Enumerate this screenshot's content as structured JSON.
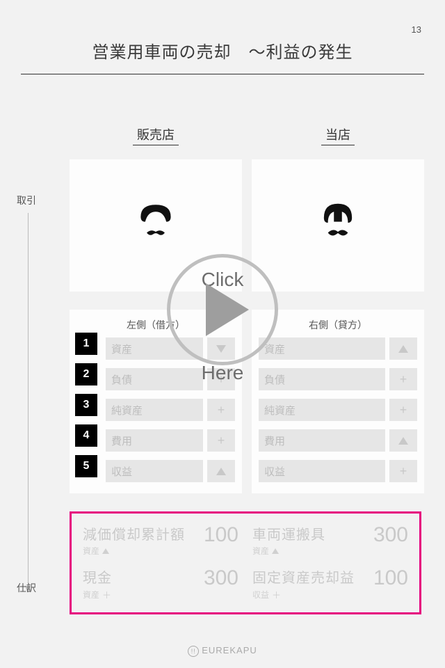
{
  "page_number": "13",
  "title": "営業用車両の売却　〜利益の発生",
  "side_labels": {
    "transaction": "取引",
    "journal": "仕訳"
  },
  "columns": {
    "left": "販売店",
    "right": "当店"
  },
  "table_headers": {
    "debit": "左側（借方）",
    "credit": "右側（貸方）"
  },
  "row_numbers": [
    "1",
    "2",
    "3",
    "4",
    "5"
  ],
  "categories": {
    "asset": "資産",
    "liability": "負債",
    "equity": "純資産",
    "expense": "費用",
    "revenue": "収益"
  },
  "journal": {
    "debit": [
      {
        "name": "減価償却累計額",
        "sub": "資産",
        "mark": "▲",
        "value": "100"
      },
      {
        "name": "現金",
        "sub": "資産",
        "mark": "＋",
        "value": "300"
      }
    ],
    "credit": [
      {
        "name": "車両運搬具",
        "sub": "資産",
        "mark": "▲",
        "value": "300"
      },
      {
        "name": "固定資産売却益",
        "sub": "収益",
        "mark": "＋",
        "value": "100"
      }
    ]
  },
  "overlay": {
    "click": "Click",
    "here": "Here"
  },
  "footer": "EUREKAPU"
}
